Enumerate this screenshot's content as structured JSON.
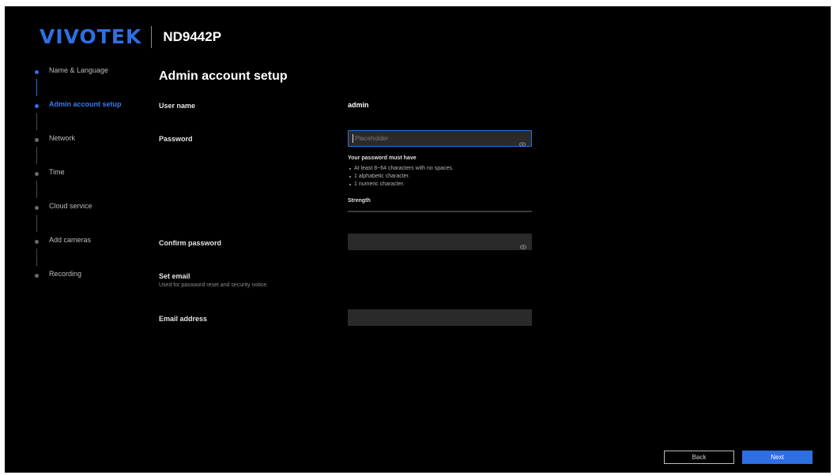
{
  "header": {
    "brand": "VIVOTEK",
    "model": "ND9442P"
  },
  "steps": [
    {
      "label": "Name & Language",
      "state": "done"
    },
    {
      "label": "Admin account setup",
      "state": "active"
    },
    {
      "label": "Network",
      "state": "pending"
    },
    {
      "label": "Time",
      "state": "pending"
    },
    {
      "label": "Cloud service",
      "state": "pending"
    },
    {
      "label": "Add cameras",
      "state": "pending"
    },
    {
      "label": "Recording",
      "state": "pending"
    }
  ],
  "content": {
    "title": "Admin account setup",
    "username_label": "User name",
    "username_value": "admin",
    "password_label": "Password",
    "password_placeholder": "Placeholder",
    "password_rules_title": "Your password must have",
    "password_rules": [
      "At least 8~64 characters with no spaces.",
      "1 alphabetic character.",
      "1 numeric character."
    ],
    "strength_label": "Strength",
    "confirm_password_label": "Confirm password",
    "set_email_label": "Set email",
    "set_email_sub": "Used for password reset and security notice.",
    "email_label": "Email address"
  },
  "footer": {
    "back_label": "Back",
    "next_label": "Next"
  },
  "colors": {
    "accent": "#2f6fe4",
    "background": "#000000",
    "input_bg": "#2a2a2a"
  },
  "icons": {
    "password_toggle": "eye-icon"
  }
}
